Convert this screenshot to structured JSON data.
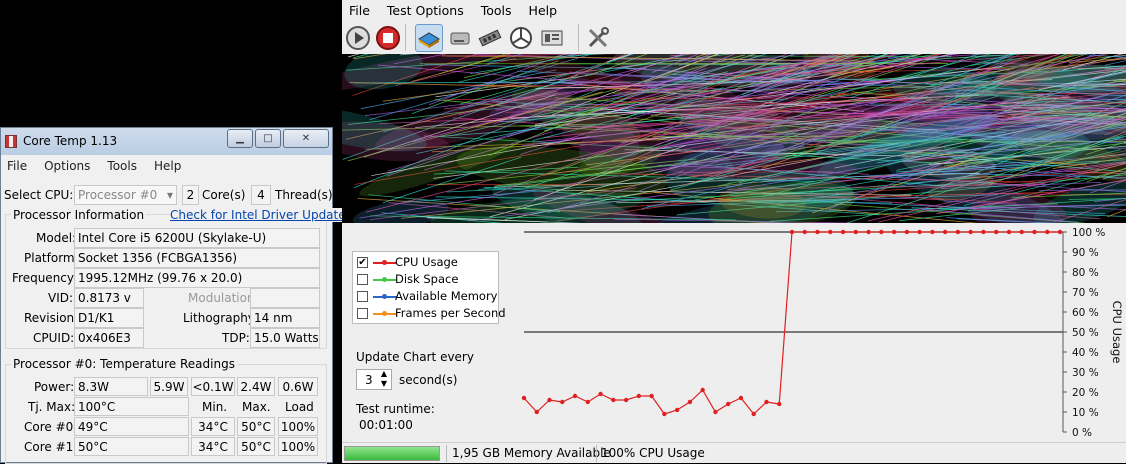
{
  "coretemp": {
    "title": "Core Temp 1.13",
    "menu": [
      "File",
      "Options",
      "Tools",
      "Help"
    ],
    "select_cpu_label": "Select CPU:",
    "select_cpu_value": "Processor #0",
    "cores": "2",
    "cores_label": "Core(s)",
    "threads": "4",
    "threads_label": "Thread(s)",
    "proc_info_label": "Processor Information",
    "driver_link": "Check for Intel Driver Updates",
    "model_label": "Model:",
    "model": "Intel Core i5 6200U (Skylake-U)",
    "platform_label": "Platform:",
    "platform": "Socket 1356 (FCBGA1356)",
    "frequency_label": "Frequency:",
    "frequency": "1995.12MHz (99.76 x 20.0)",
    "vid_label": "VID:",
    "vid": "0.8173 v",
    "modulation_label": "Modulation:",
    "modulation": "",
    "revision_label": "Revision:",
    "revision": "D1/K1",
    "lithography_label": "Lithography:",
    "lithography": "14 nm",
    "cpuid_label": "CPUID:",
    "cpuid": "0x406E3",
    "tdp_label": "TDP:",
    "tdp": "15.0 Watts",
    "temps_label": "Processor #0: Temperature Readings",
    "power_label": "Power:",
    "power": [
      "8.3W",
      "5.9W",
      "<0.1W",
      "2.4W",
      "0.6W"
    ],
    "tjmax_label": "Tj. Max:",
    "tjmax": "100°C",
    "col_min": "Min.",
    "col_max": "Max.",
    "col_load": "Load",
    "cores_rows": [
      {
        "label": "Core #0:",
        "temp": "49°C",
        "min": "34°C",
        "max": "50°C",
        "load": "100%"
      },
      {
        "label": "Core #1:",
        "temp": "50°C",
        "min": "34°C",
        "max": "50°C",
        "load": "100%"
      }
    ]
  },
  "stress": {
    "menu": [
      "File",
      "Test Options",
      "Tools",
      "Help"
    ],
    "toolbar_icons": [
      "play-icon",
      "stop-icon",
      "cpu-test-icon",
      "disk-test-icon",
      "memory-test-icon",
      "gpu-test-icon",
      "system-info-icon",
      "settings-tools-icon"
    ],
    "legend": [
      {
        "label": "CPU Usage",
        "checked": true,
        "color": "#e02020"
      },
      {
        "label": "Disk Space",
        "checked": false,
        "color": "#46c846"
      },
      {
        "label": "Available Memory",
        "checked": false,
        "color": "#2a66c8"
      },
      {
        "label": "Frames per Second",
        "checked": false,
        "color": "#f09020"
      }
    ],
    "update_label": "Update Chart every",
    "update_value": "3",
    "update_unit": "second(s)",
    "runtime_label": "Test runtime:",
    "runtime": "00:01:00",
    "status_memory": "1,95 GB Memory Available",
    "status_cpu": "100% CPU Usage"
  },
  "chart_data": {
    "type": "line",
    "ylabel": "CPU Usage",
    "ylim": [
      0,
      100
    ],
    "yticks": [
      "0 %",
      "10 %",
      "20 %",
      "30 %",
      "40 %",
      "50 %",
      "60 %",
      "70 %",
      "80 %",
      "90 %",
      "100 %"
    ],
    "series": [
      {
        "name": "CPU Usage",
        "color": "#e02020",
        "values": [
          17,
          10,
          16,
          15,
          18,
          15,
          19,
          16,
          16,
          18,
          18,
          9,
          11,
          15,
          21,
          10,
          14,
          17,
          9,
          15,
          14,
          100,
          100,
          100,
          100,
          100,
          100,
          100,
          100,
          100,
          100,
          100,
          100,
          100,
          100,
          100,
          100,
          100,
          100,
          100,
          100,
          100,
          100
        ]
      }
    ]
  }
}
